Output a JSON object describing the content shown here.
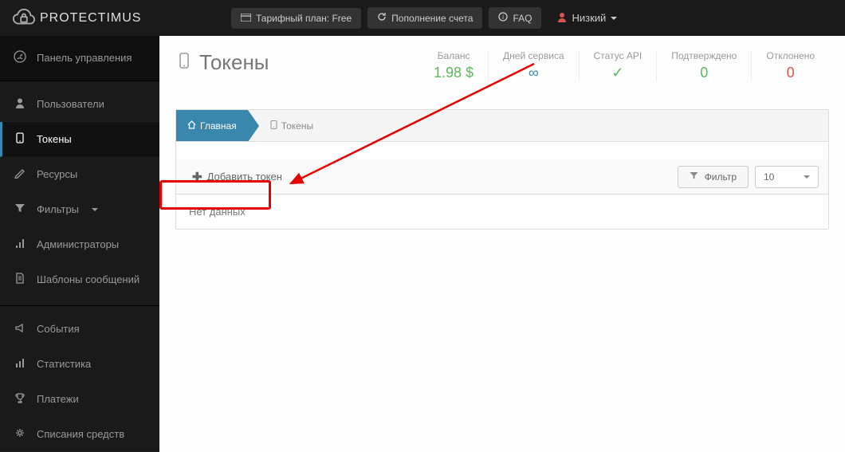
{
  "brand": "PROTECTIMUS",
  "top_nav": {
    "tariff": "Тарифный план: Free",
    "topup": "Пополнение счета",
    "faq": "FAQ",
    "user": "Низкий"
  },
  "sidebar": {
    "dashboard": "Панель управления",
    "users": "Пользователи",
    "tokens": "Токены",
    "resources": "Ресурсы",
    "filters": "Фильтры",
    "admins": "Администраторы",
    "templates": "Шаблоны сообщений",
    "events": "События",
    "stats": "Статистика",
    "payments": "Платежи",
    "debits": "Списания средств"
  },
  "page": {
    "title": "Токены",
    "stats": {
      "balance_label": "Баланс",
      "balance_value": "1.98 $",
      "days_label": "Дней сервиса",
      "days_value": "∞",
      "api_label": "Статус API",
      "api_value": "✓",
      "confirmed_label": "Подтверждено",
      "confirmed_value": "0",
      "rejected_label": "Отклонено",
      "rejected_value": "0"
    }
  },
  "breadcrumb": {
    "home": "Главная",
    "current": "Токены"
  },
  "toolbar": {
    "add": "Добавить токен",
    "filter": "Фильтр",
    "pagesize": "10"
  },
  "table": {
    "empty": "Нет данных"
  }
}
